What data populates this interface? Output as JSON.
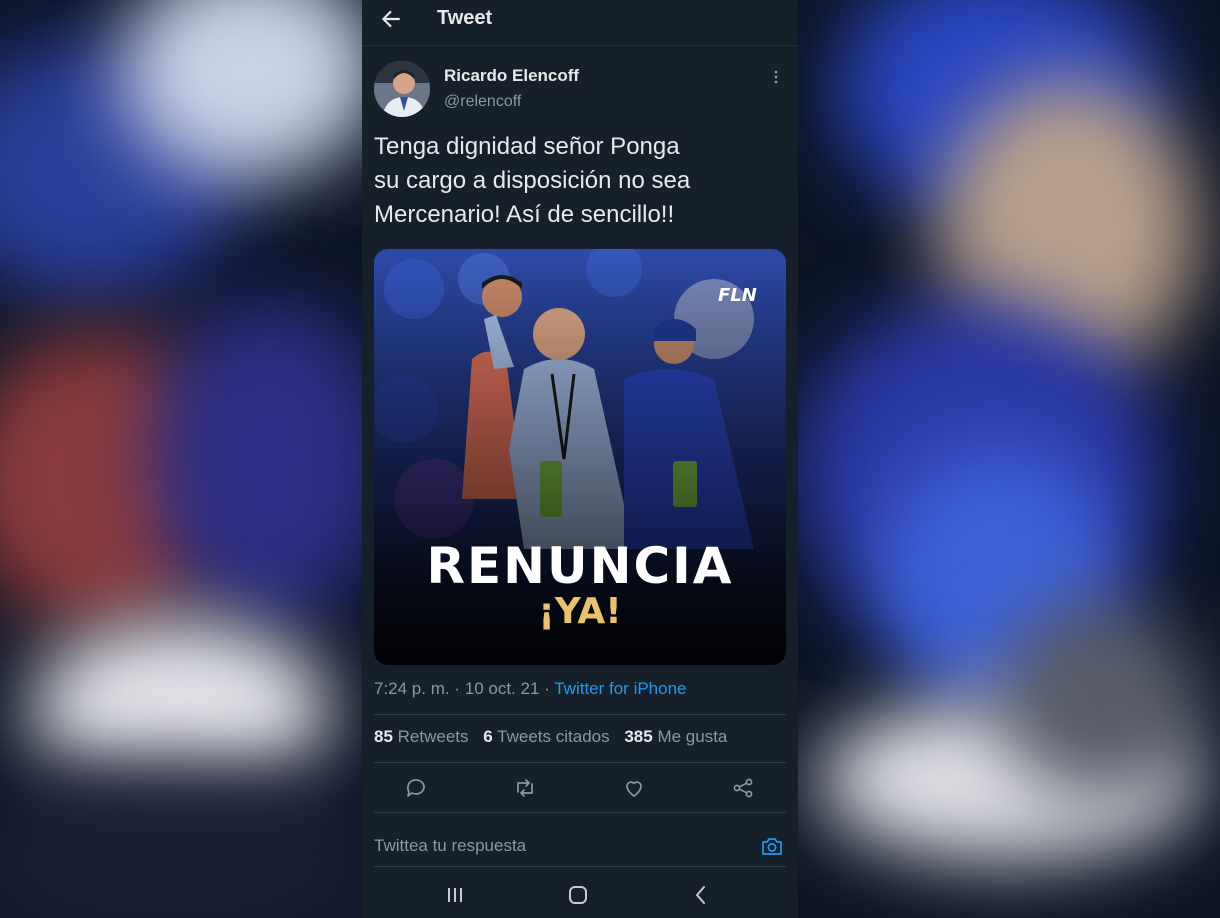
{
  "header": {
    "title": "Tweet"
  },
  "author": {
    "name": "Ricardo Elencoff",
    "handle": "@relencoff"
  },
  "tweet": {
    "lines": [
      "Tenga dignidad señor Ponga",
      "su cargo a disposición no sea",
      "Mercenario! Así de sencillo!!"
    ],
    "media": {
      "headline": "RENUNCIA",
      "subheadline": "¡YA!",
      "watermark": "FLN"
    },
    "time": "7:24 p. m.",
    "date": "10 oct. 21",
    "source": "Twitter for iPhone"
  },
  "stats": {
    "retweets_count": "85",
    "retweets_label": "Retweets",
    "quotes_count": "6",
    "quotes_label": "Tweets citados",
    "likes_count": "385",
    "likes_label": "Me gusta"
  },
  "reply": {
    "placeholder": "Twittea tu respuesta"
  },
  "icons": {
    "back": "arrow-left-icon",
    "more": "more-vertical-icon",
    "reply": "comment-icon",
    "retweet": "retweet-icon",
    "like": "heart-icon",
    "share": "share-icon",
    "camera": "camera-icon",
    "nav_recents": "recents-icon",
    "nav_home": "home-icon",
    "nav_back": "back-chevron-icon"
  },
  "colors": {
    "background": "#15202b",
    "text": "#e7e9ea",
    "muted": "#8b98a5",
    "link": "#1d9bf0",
    "accent_gold": "#e9c26b"
  }
}
